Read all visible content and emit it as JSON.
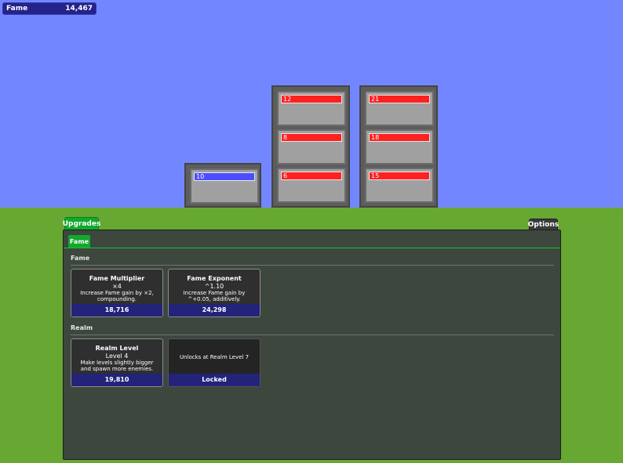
{
  "hud": {
    "fame_label": "Fame",
    "fame_value": "14,467"
  },
  "towers": [
    {
      "hp": [
        "10"
      ],
      "bar_color": "blue"
    },
    {
      "hp": [
        "12",
        "8",
        "6"
      ],
      "bar_color": "red"
    },
    {
      "hp": [
        "21",
        "18",
        "15"
      ],
      "bar_color": "red"
    }
  ],
  "tabs": {
    "upgrades": "Upgrades",
    "options": "Options",
    "fame_subtab": "Fame"
  },
  "sections": {
    "fame": {
      "title": "Fame",
      "cards": [
        {
          "name": "Fame Multiplier",
          "level": "×4",
          "desc_line1": "Increase Fame gain by ×2,",
          "desc_line2": "compounding.",
          "price": "18,716"
        },
        {
          "name": "Fame Exponent",
          "level": "^1.10",
          "desc_line1": "Increase Fame gain by",
          "desc_line2": "^+0.05, additively.",
          "price": "24,298"
        }
      ]
    },
    "realm": {
      "title": "Realm",
      "cards": [
        {
          "name": "Realm Level",
          "level": "Level 4",
          "desc_line1": "Make levels slightly bigger",
          "desc_line2": "and spawn more enemies.",
          "price": "19,810"
        },
        {
          "locked_msg": "Unlocks at Realm Level 7",
          "price": "Locked"
        }
      ]
    }
  },
  "colors": {
    "sky": "#7287ff",
    "ground": "#66a832",
    "accent_green": "#12a82c",
    "hp_red": "#ff2020",
    "hp_blue": "#4d4dff",
    "price_bar": "#23237a"
  }
}
